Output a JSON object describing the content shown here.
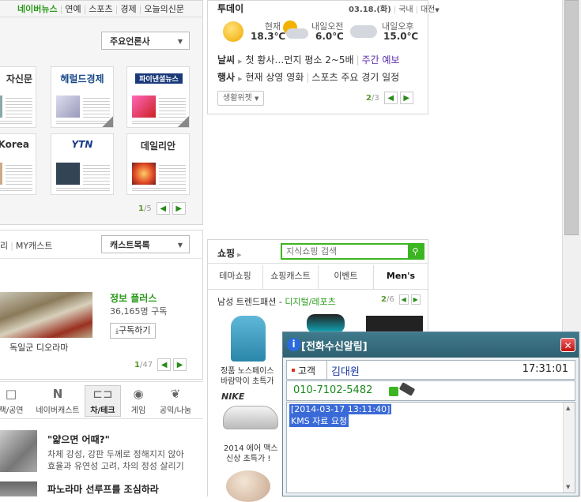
{
  "news_tabs": [
    "네이버뉴스",
    "연예",
    "스포츠",
    "경제",
    "오늘의신문"
  ],
  "news_select": "주요언론사",
  "papers": [
    {
      "name": "자신문",
      "color": "#222"
    },
    {
      "name": "헤럴드경제",
      "color": "#1a4a8a"
    },
    {
      "name": "파이낸셜뉴스",
      "color": "#fff"
    },
    {
      "name": "et Korea",
      "color": "#222"
    },
    {
      "name": "YTN",
      "color": "#1a3a8a"
    },
    {
      "name": "데일리안",
      "color": "#222"
    }
  ],
  "news_pager": {
    "current": "1",
    "total": "/5"
  },
  "today": {
    "title": "투데이",
    "date": "03.18.(화)",
    "region": "국내",
    "city": "대전",
    "weather": [
      {
        "label": "현재",
        "temp": "18.3℃"
      },
      {
        "label": "내일오전",
        "temp": "6.0℃"
      },
      {
        "label": "내일오후",
        "temp": "15.0℃"
      }
    ],
    "line1_label": "날씨",
    "line1_text": "첫 황사…먼지 평소 2~5배",
    "line1_link": "주간 예보",
    "line2_label": "행사",
    "line2_text": "현재 상영 영화",
    "line2_text2": "스포츠 주요 경기 일정",
    "widget_btn": "생활위젯",
    "pager": {
      "current": "2",
      "total": "/3"
    }
  },
  "cast": {
    "tabs_partial": "리",
    "tab_my": "MY캐스트",
    "select": "캐스트목록",
    "item_title": "정보 플러스",
    "item_subs": "36,165명 구독",
    "subscribe_btn": "구독하기",
    "image_caption": "독일군 디오라마",
    "pager": {
      "current": "1",
      "total": "/47"
    }
  },
  "categories": [
    {
      "label": "책/공연",
      "icon": "□"
    },
    {
      "label": "네이버캐스트",
      "icon": "N"
    },
    {
      "label": "차/테크",
      "icon": "⊏⊐"
    },
    {
      "label": "게임",
      "icon": "◉"
    },
    {
      "label": "공익/나눔",
      "icon": "❦"
    }
  ],
  "article": {
    "title": "\"얇으면 어때?\"",
    "body1": "차체 강성, 강판 두께로 정해지지 않아",
    "body2": "효율과 유연성 고려, 차의 정성 살리기",
    "title2": "파노라마 선루프를 조심하라"
  },
  "shopping": {
    "title": "쇼핑",
    "search_placeholder": "지식쇼핑 검색",
    "tabs": [
      "테마쇼핑",
      "쇼핑캐스트",
      "이벤트",
      "Men's"
    ],
    "trend_label": "남성 트렌드패션 -",
    "trend_link": "디지털/레포츠",
    "pager": {
      "current": "2",
      "total": "/6"
    },
    "items": [
      {
        "caption1": "정품 노스페이스",
        "caption2": "바람막이 초특가"
      },
      {
        "caption1": "2014 에어 맥스",
        "caption2": "신상 초특가 !"
      }
    ]
  },
  "popup": {
    "title": "[전화수신알림]",
    "customer_label": "고객",
    "customer_name": "김대원",
    "time": "17:31:01",
    "phone": "010-7102-5482",
    "memo_line1": "[2014-03-17 13:11:40]",
    "memo_line2": "KMS 자료 요청"
  }
}
